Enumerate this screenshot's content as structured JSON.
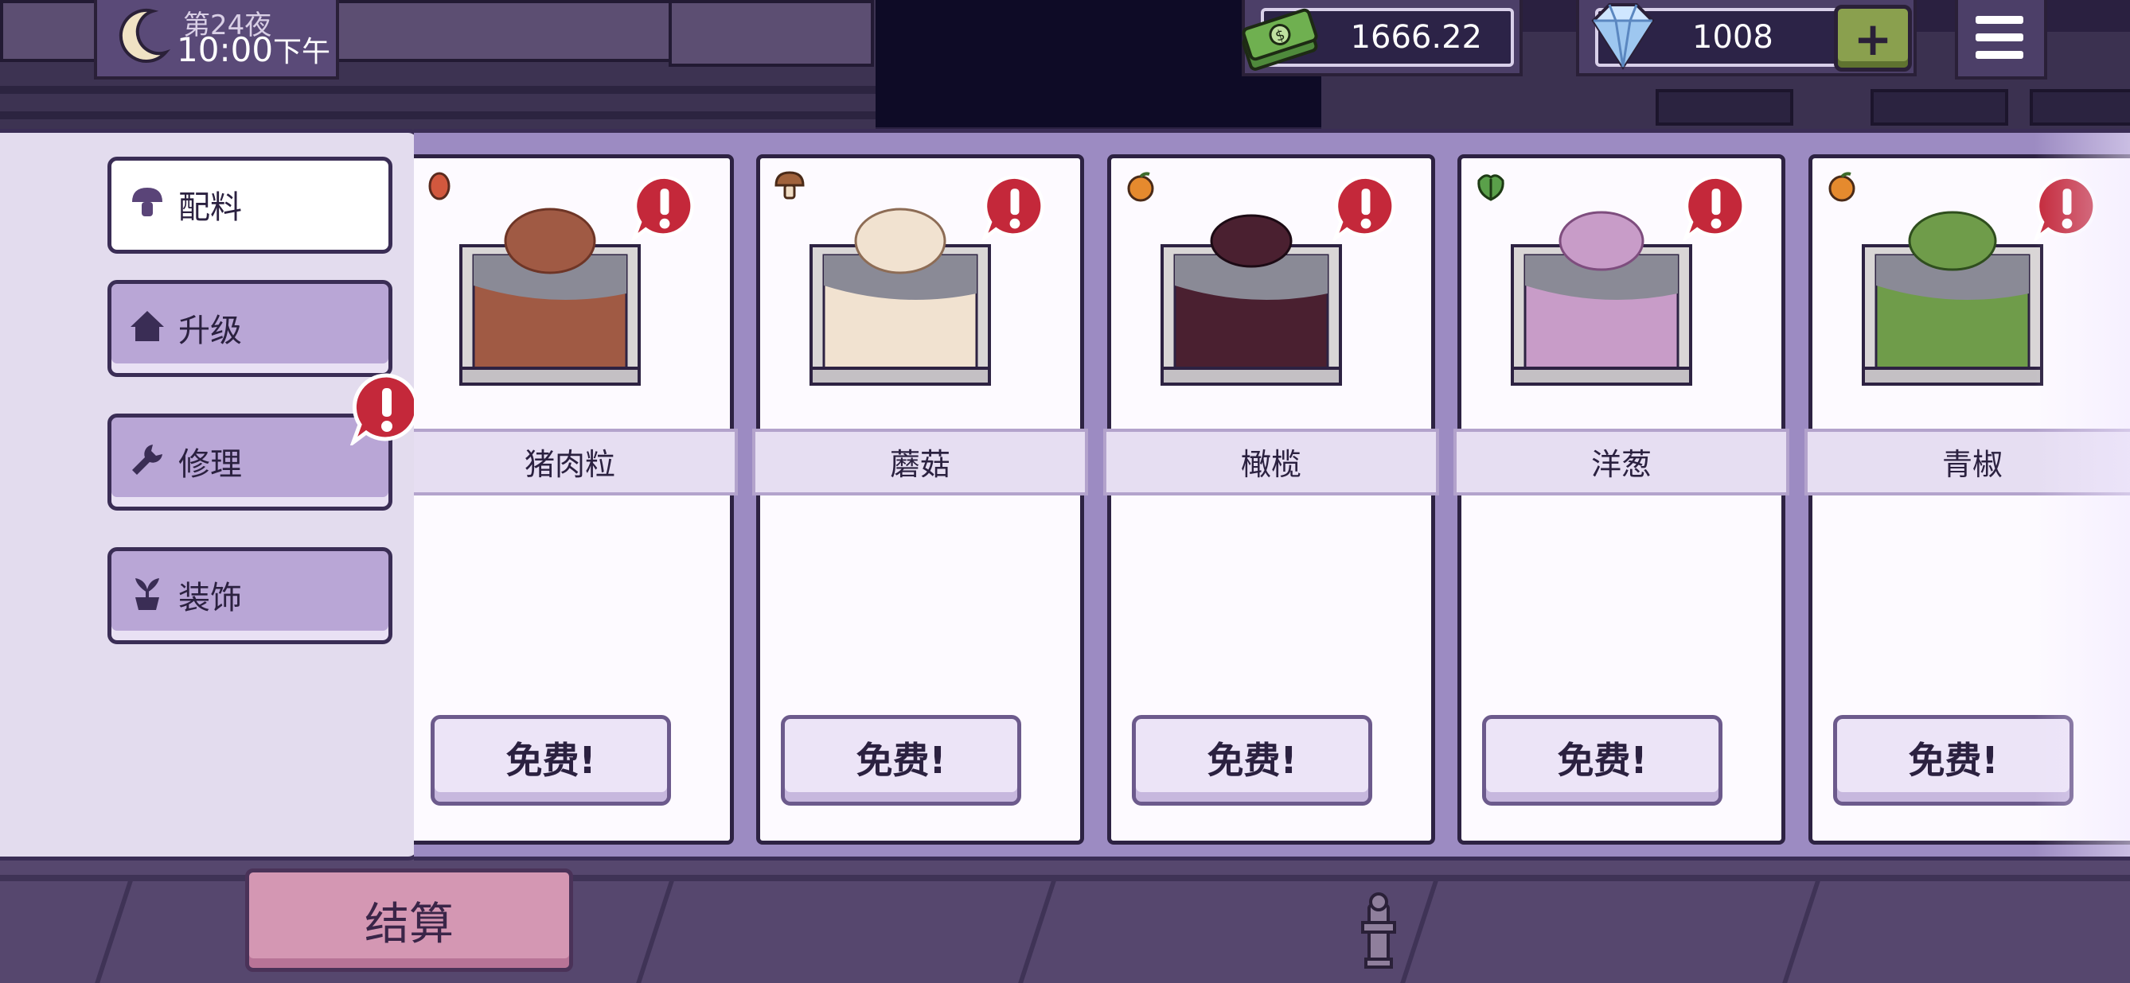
{
  "hud": {
    "day_label": "第24夜",
    "time": "10:00",
    "time_suffix": "下午",
    "cash": "1666.22",
    "gems": "1008",
    "add_gems_icon": "plus-icon",
    "menu_icon": "hamburger-menu-icon"
  },
  "side_menu": {
    "items": [
      {
        "label": "配料",
        "icon": "mushroom-icon",
        "active": true
      },
      {
        "label": "升级",
        "icon": "house-icon",
        "active": false
      },
      {
        "label": "修理",
        "icon": "wrench-icon",
        "active": false,
        "alert": true
      },
      {
        "label": "装饰",
        "icon": "potted-plant-icon",
        "active": false
      }
    ]
  },
  "ingredients": [
    {
      "name": "猪肉粒",
      "button": "免费!",
      "tag_icon": "meat-icon",
      "color": "#a05a44",
      "dark": "#6e3526"
    },
    {
      "name": "蘑菇",
      "button": "免费!",
      "tag_icon": "mushroom-icon",
      "color": "#f1e2d0",
      "dark": "#8d6c55"
    },
    {
      "name": "橄榄",
      "button": "免费!",
      "tag_icon": "orange-fruit-icon",
      "color": "#4a2030",
      "dark": "#1c0a14"
    },
    {
      "name": "洋葱",
      "button": "免费!",
      "tag_icon": "leafy-green-icon",
      "color": "#c89cc8",
      "dark": "#7e4d7e"
    },
    {
      "name": "青椒",
      "button": "免费!",
      "tag_icon": "orange-fruit-icon",
      "color": "#6f9c4a",
      "dark": "#2f4e1e"
    }
  ],
  "checkout": {
    "label": "结算"
  },
  "colors": {
    "panel": "#9c8bc2",
    "alert_red": "#c4283a",
    "accent_green": "#8aa04e"
  }
}
